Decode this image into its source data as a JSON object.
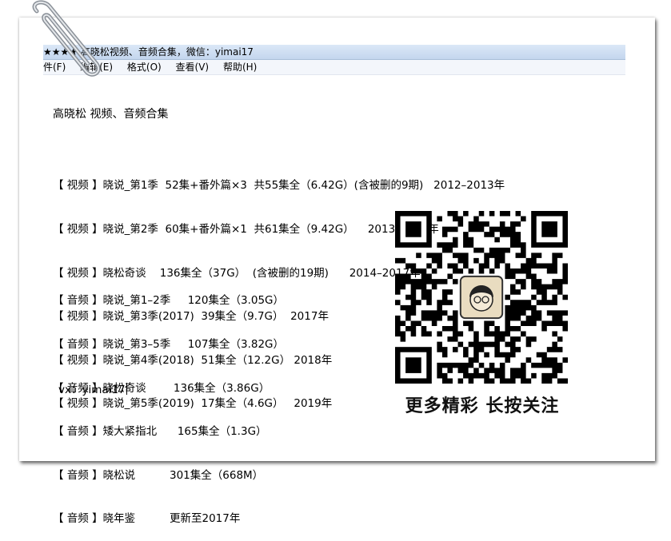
{
  "window": {
    "title": "★★★★ 高晓松视频、音频合集，微信：yimai17"
  },
  "menu": {
    "items": [
      "件(F)",
      "编辑(E)",
      "格式(O)",
      "查看(V)",
      "帮助(H)"
    ]
  },
  "document": {
    "heading": "高晓松  视频、音频合集",
    "video_lines": [
      "【 视频 】晓说_第1季  52集+番外篇×3  共55集全（6.42G）(含被删的9期)   2012–2013年",
      "【 视频 】晓说_第2季  60集+番外篇×1  共61集全（9.42G）    2013–2014年",
      "【 视频 】晓松奇谈    136集全（37G）  (含被删的19期)      2014–2017年",
      "【 视频 】晓说_第3季(2017)  39集全（9.7G）  2017年",
      "【 视频 】晓说_第4季(2018)  51集全（12.2G） 2018年",
      "【 视频 】晓说_第5季(2019)  17集全（4.6G）   2019年"
    ],
    "audio_lines": [
      "【 音频 】晓说_第1–2季     120集全（3.05G）",
      "【 音频 】晓说_第3–5季     107集全（3.82G）",
      "【 音频 】晓松奇谈        136集全（3.86G）",
      "【 音频 】矮大紧指北      165集全（1.3G）",
      "【 音频 】晓松说          301集全（668M）",
      "【 音频 】晓年鉴          更新至2017年"
    ],
    "contact": "vx：yimai17"
  },
  "qr": {
    "caption": "更多精彩 长按关注"
  }
}
